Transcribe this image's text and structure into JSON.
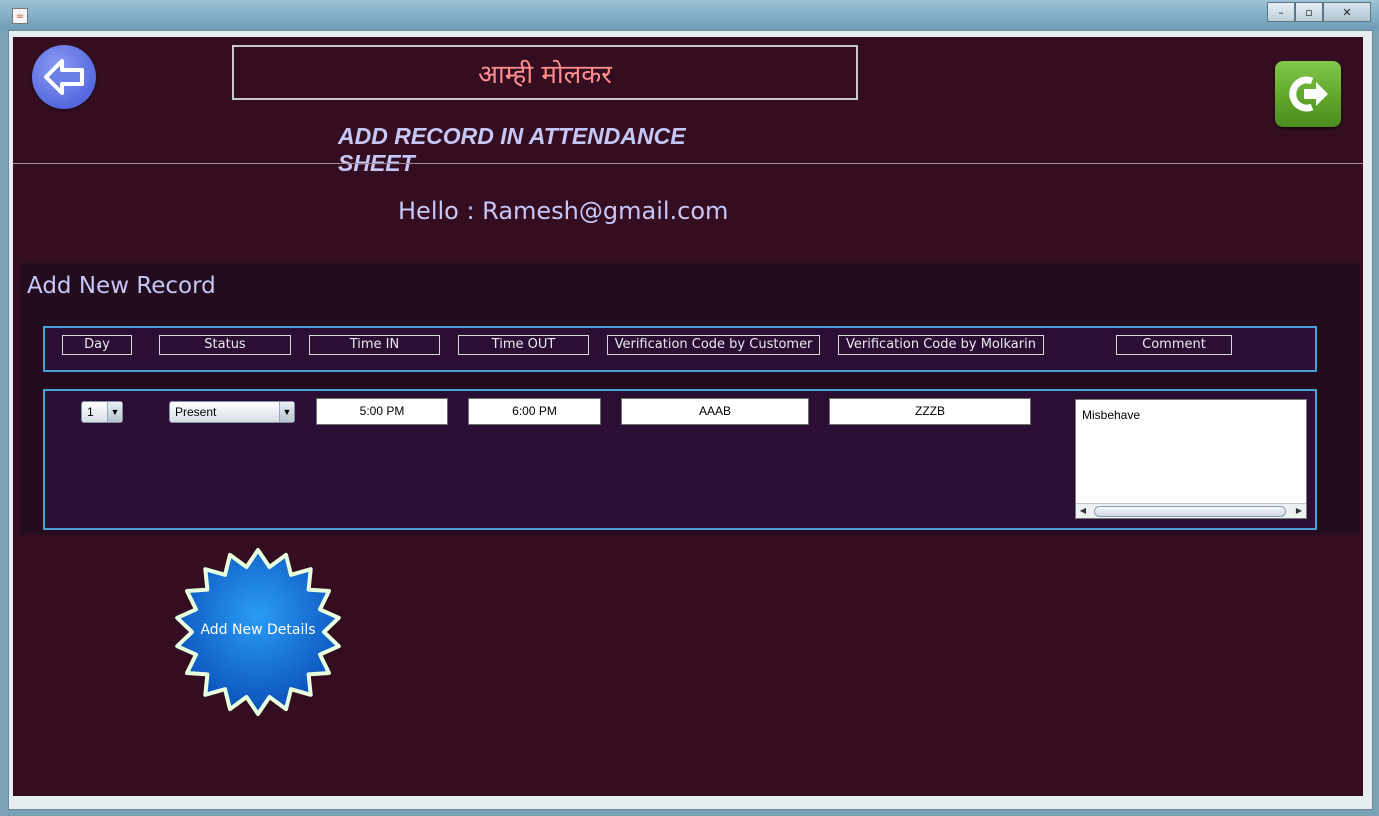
{
  "window": {
    "app_icon": "java-icon",
    "controls": {
      "minimize": "–",
      "maximize": "▫",
      "close": "✕"
    }
  },
  "header": {
    "back_icon": "arrow-left-icon",
    "app_title": "आम्ही मोलकर",
    "subtitle": "ADD RECORD IN ATTENDANCE SHEET",
    "logout_icon": "logout-icon"
  },
  "greeting": "Hello : Ramesh@gmail.com",
  "record_panel": {
    "title": "Add New Record",
    "columns": [
      "Day",
      "Status",
      "Time IN",
      "Time OUT",
      "Verification Code by Customer",
      "Verification Code by Molkarin",
      "Comment"
    ],
    "row": {
      "day": "1",
      "status": "Present",
      "time_in": "5:00 PM",
      "time_out": "6:00 PM",
      "code_customer": "AAAB",
      "code_molkarin": "ZZZB",
      "comment": "Misbehave"
    }
  },
  "add_button": {
    "label": "Add New Details"
  },
  "colors": {
    "background": "#340e20",
    "panel": "#220c1d",
    "row_border": "#4a9fd6",
    "title_text": "#ff8f8f",
    "label_text": "#c7c7f7",
    "add_button": "#0a6fd6",
    "logout": "#5ea329",
    "back": "#5569de"
  }
}
